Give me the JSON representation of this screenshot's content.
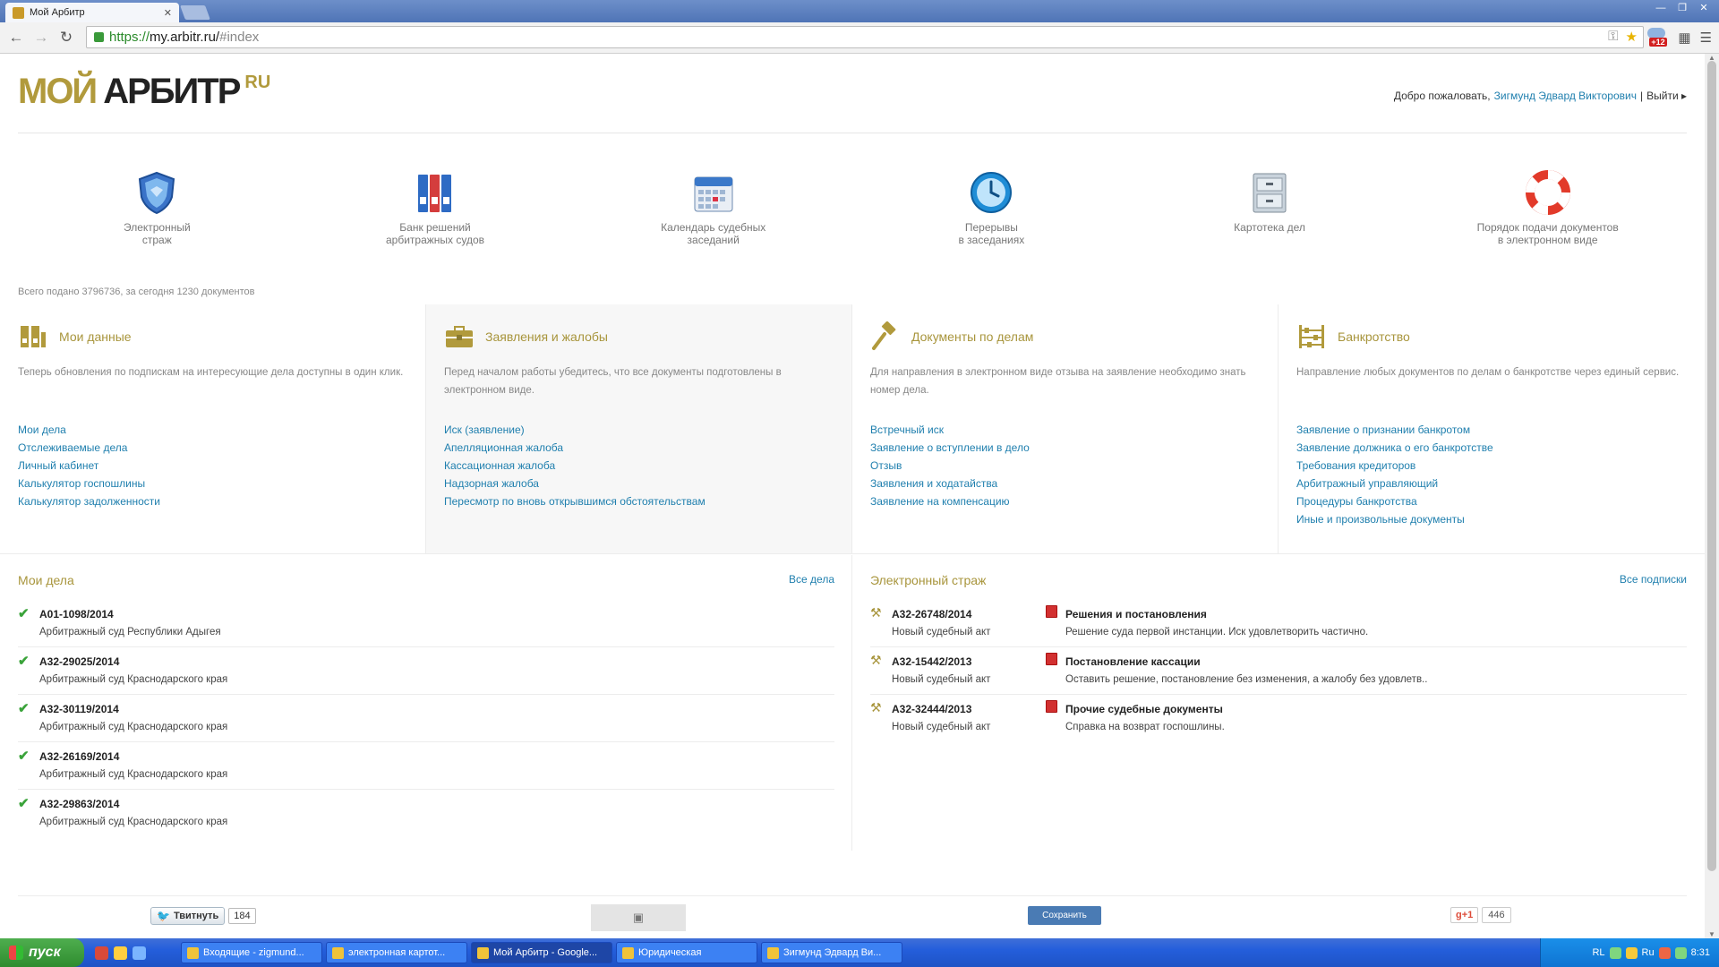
{
  "browser": {
    "tab_title": "Мой Арбитр",
    "url_proto": "https://",
    "url_host": "my.arbitr.ru/",
    "url_hash": "#index",
    "ext_badge": "+12"
  },
  "logo": {
    "part1": "МОЙ",
    "part2": "АРБИТР",
    "part3": "RU"
  },
  "header": {
    "welcome": "Добро пожаловать,",
    "user_name": "Зигмунд Эдвард Викторович",
    "separator": "|",
    "logout": "Выйти ▸"
  },
  "services": [
    {
      "label": "Электронный\nстраж",
      "icon": "shield-icon"
    },
    {
      "label": "Банк решений\nарбитражных судов",
      "icon": "binders-icon"
    },
    {
      "label": "Календарь судебных\nзаседаний",
      "icon": "calendar-icon"
    },
    {
      "label": "Перерывы\nв заседаниях",
      "icon": "clock-icon"
    },
    {
      "label": "Картотека дел",
      "icon": "file-cabinet-icon"
    },
    {
      "label": "Порядок подачи документов\nв электронном виде",
      "icon": "lifebuoy-icon"
    }
  ],
  "total_text": "Всего подано 3796736, за сегодня 1230 документов",
  "columns": [
    {
      "title": "Мои данные",
      "desc": "Теперь обновления по подпискам на интересующие дела доступны в один клик.",
      "links": [
        "Мои дела",
        "Отслеживаемые дела",
        "Личный кабинет",
        "Калькулятор госпошлины",
        "Калькулятор задолженности"
      ]
    },
    {
      "title": "Заявления и жалобы",
      "desc": "Перед началом работы убедитесь, что все документы подготовлены в электронном виде.",
      "links": [
        "Иск (заявление)",
        "Апелляционная жалоба",
        "Кассационная жалоба",
        "Надзорная жалоба",
        "Пересмотр по вновь открывшимся обстоятельствам"
      ]
    },
    {
      "title": "Документы по делам",
      "desc": "Для направления в электронном виде отзыва на заявление необходимо знать номер дела.",
      "links": [
        "Встречный иск",
        "Заявление о вступлении в дело",
        "Отзыв",
        "Заявления и ходатайства",
        "Заявление на компенсацию"
      ]
    },
    {
      "title": "Банкротство",
      "desc": "Направление любых документов по делам о банкротстве через единый сервис.",
      "links": [
        "Заявление о признании банкротом",
        "Заявление должника о его банкротстве",
        "Требования кредиторов",
        "Арбитражный управляющий",
        "Процедуры банкротства",
        "Иные и произвольные документы"
      ]
    }
  ],
  "my_cases": {
    "title": "Мои дела",
    "all_link": "Все дела",
    "items": [
      {
        "number": "А01-1098/2014",
        "court": "Арбитражный суд Республики Адыгея"
      },
      {
        "number": "А32-29025/2014",
        "court": "Арбитражный суд Краснодарского края"
      },
      {
        "number": "А32-30119/2014",
        "court": "Арбитражный суд Краснодарского края"
      },
      {
        "number": "А32-26169/2014",
        "court": "Арбитражный суд Краснодарского края"
      },
      {
        "number": "А32-29863/2014",
        "court": "Арбитражный суд Краснодарского края"
      }
    ]
  },
  "guard": {
    "title": "Электронный страж",
    "all_link": "Все подписки",
    "items": [
      {
        "number": "А32-26748/2014",
        "sub": "Новый судебный акт",
        "doc_title": "Решения и постановления",
        "doc_desc": "Решение суда первой инстанции. Иск удовлетворить частично."
      },
      {
        "number": "А32-15442/2013",
        "sub": "Новый судебный акт",
        "doc_title": "Постановление кассации",
        "doc_desc": "Оставить решение, постановление без изменения, а жалобу без удовлетв.."
      },
      {
        "number": "А32-32444/2013",
        "sub": "Новый судебный акт",
        "doc_title": "Прочие судебные документы",
        "doc_desc": "Справка на возврат госпошлины."
      }
    ]
  },
  "social": {
    "tweet_label": "Твитнуть",
    "tweet_count": "184",
    "save_label": "Сохранить",
    "gplus_label": "g+1",
    "gplus_count": "446"
  },
  "taskbar": {
    "start_label": "пуск",
    "tasks": [
      "Входящие - zigmund...",
      "электронная картот...",
      "Мой Арбитр - Google...",
      "Юридическая",
      "Зигмунд Эдвард Ви..."
    ],
    "lang": "RL",
    "lang2": "Ru",
    "time": "8:31"
  }
}
